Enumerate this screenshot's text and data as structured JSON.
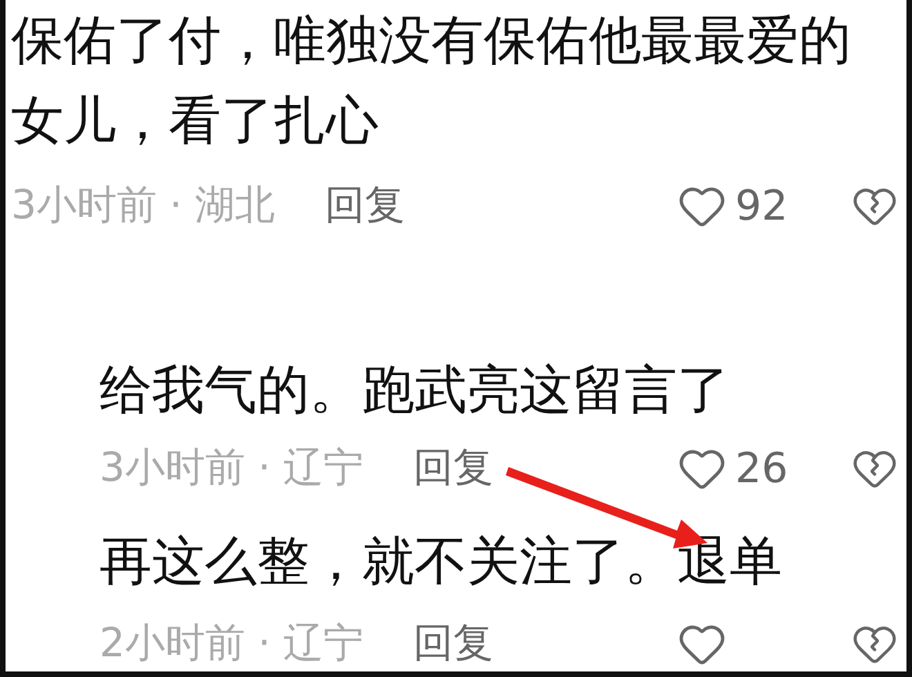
{
  "comments": [
    {
      "text": "保佑了付，唯独没有保佑他最最爱的女儿，看了扎心",
      "time_location": "3小时前 · 湖北",
      "reply_label": "回复",
      "likes": "92",
      "children": [
        {
          "text": "给我气的。跑武亮这留言了",
          "time_location": "3小时前 · 辽宁",
          "reply_label": "回复",
          "likes": "26"
        },
        {
          "text": "再这么整，就不关注了。退单",
          "time_location": "2小时前 · 辽宁",
          "reply_label": "回复"
        }
      ]
    }
  ]
}
